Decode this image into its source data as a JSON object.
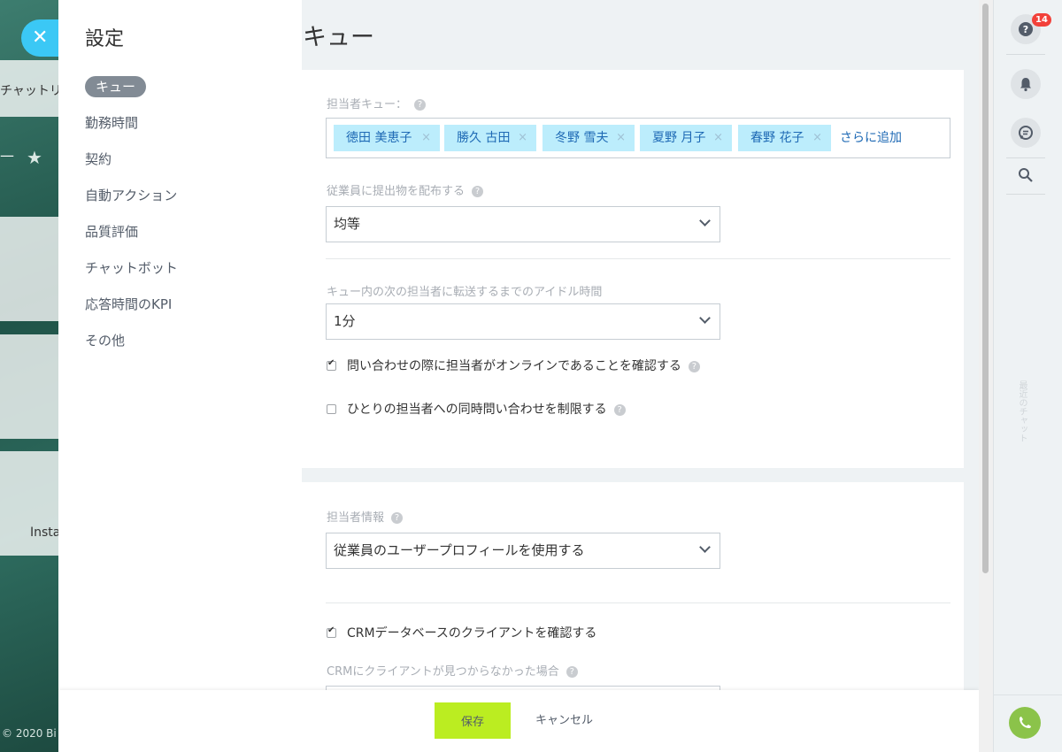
{
  "background": {
    "close_glyph": "✕",
    "peek_text_1": "チャットリ",
    "peek_text_2": "Insta",
    "peek_dash": "—",
    "peek_star": "★",
    "copyright": "© 2020 Bi"
  },
  "nav": {
    "title": "設定",
    "items": [
      {
        "label": "キュー",
        "active": true
      },
      {
        "label": "勤務時間",
        "active": false
      },
      {
        "label": "契約",
        "active": false
      },
      {
        "label": "自動アクション",
        "active": false
      },
      {
        "label": "品質評価",
        "active": false
      },
      {
        "label": "チャットボット",
        "active": false
      },
      {
        "label": "応答時間のKPI",
        "active": false
      },
      {
        "label": "その他",
        "active": false
      }
    ]
  },
  "page": {
    "title": "キュー"
  },
  "queue": {
    "label": "担当者キュー：",
    "help": "?",
    "agents": [
      "徳田 美恵子",
      "勝久 古田",
      "冬野 雪夫",
      "夏野 月子",
      "春野 花子"
    ],
    "remove_glyph": "×",
    "add_more": "さらに追加"
  },
  "distribution": {
    "label": "従業員に提出物を配布する",
    "value": "均等"
  },
  "idle_time": {
    "label": "キュー内の次の担当者に転送するまでのアイドル時間",
    "value": "1分"
  },
  "checks": {
    "online_check": {
      "label": "問い合わせの際に担当者がオンラインであることを確認する",
      "checked": true
    },
    "limit_check": {
      "label": "ひとりの担当者への同時問い合わせを制限する",
      "checked": false
    },
    "crm_check": {
      "label": "CRMデータベースのクライアントを確認する",
      "checked": true
    }
  },
  "agent_info": {
    "label": "担当者情報",
    "value": "従業員のユーザープロフィールを使用する"
  },
  "crm_not_found": {
    "label": "CRMにクライアントが見つからなかった場合"
  },
  "footer": {
    "save": "保存",
    "cancel": "キャンセル"
  },
  "rail": {
    "help_badge": "14",
    "vertical_text": "最近のチャット"
  },
  "colors": {
    "accent_blue": "#3bc8f5",
    "save_green": "#bbed21",
    "tag_bg": "#bcedfc",
    "tag_text": "#1f6ab5",
    "badge_red": "#f2413a",
    "phone_green": "#8bc34a"
  }
}
